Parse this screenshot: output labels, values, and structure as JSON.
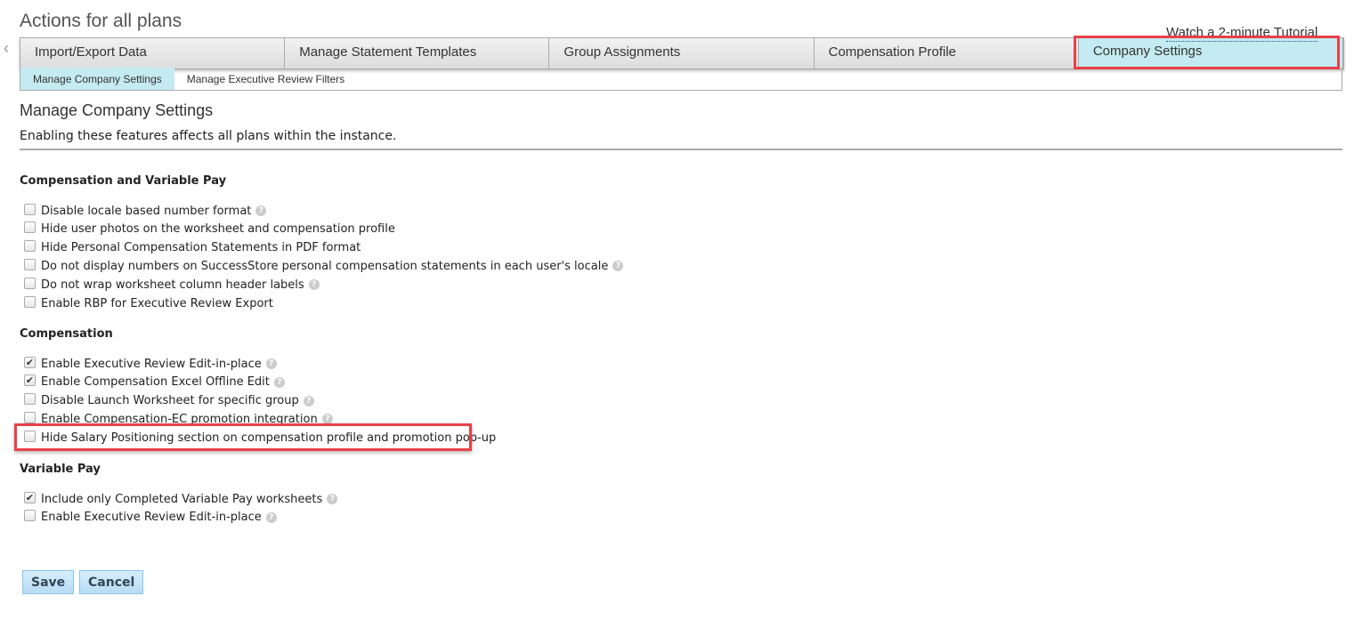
{
  "page_title": "Actions for all plans",
  "tutorial_link": "Watch a 2-minute Tutorial",
  "tabs": [
    "Import/Export Data",
    "Manage Statement Templates",
    "Group Assignments",
    "Compensation Profile",
    "Company Settings"
  ],
  "active_tab": "Company Settings",
  "subtabs": [
    "Manage Company Settings",
    "Manage Executive Review Filters"
  ],
  "section_title": "Manage Company Settings",
  "description": "Enabling these features affects all plans within the instance.",
  "sections": [
    {
      "heading": "Compensation and Variable Pay",
      "items": [
        {
          "label": "Disable locale based number format",
          "checked": false,
          "help": true
        },
        {
          "label": "Hide user photos on the worksheet and compensation profile",
          "checked": false,
          "help": false
        },
        {
          "label": "Hide Personal Compensation Statements in PDF format",
          "checked": false,
          "help": false
        },
        {
          "label": "Do not display numbers on SuccessStore personal compensation statements in each user's locale",
          "checked": false,
          "help": true
        },
        {
          "label": "Do not wrap worksheet column header labels",
          "checked": false,
          "help": true
        },
        {
          "label": "Enable RBP for Executive Review Export",
          "checked": false,
          "help": false
        }
      ]
    },
    {
      "heading": "Compensation",
      "items": [
        {
          "label": "Enable Executive Review Edit-in-place",
          "checked": true,
          "help": true
        },
        {
          "label": "Enable Compensation Excel Offline Edit",
          "checked": true,
          "help": true
        },
        {
          "label": "Disable Launch Worksheet for specific group",
          "checked": false,
          "help": true
        },
        {
          "label": "Enable Compensation-EC promotion integration",
          "checked": false,
          "help": true
        },
        {
          "label": "Hide Salary Positioning section on compensation profile and promotion pop-up",
          "checked": false,
          "help": false
        }
      ]
    },
    {
      "heading": "Variable Pay",
      "items": [
        {
          "label": "Include only Completed Variable Pay worksheets",
          "checked": true,
          "help": true
        },
        {
          "label": "Enable Executive Review Edit-in-place",
          "checked": false,
          "help": true
        }
      ]
    }
  ],
  "buttons": {
    "save": "Save",
    "cancel": "Cancel"
  },
  "icons": {
    "back": "chevron-left-icon",
    "help": "help-icon",
    "check": "checkmark-icon"
  },
  "colors": {
    "active_tab": "#c4ebf1",
    "highlight": "#e94048",
    "button": "#b7dcf5"
  }
}
